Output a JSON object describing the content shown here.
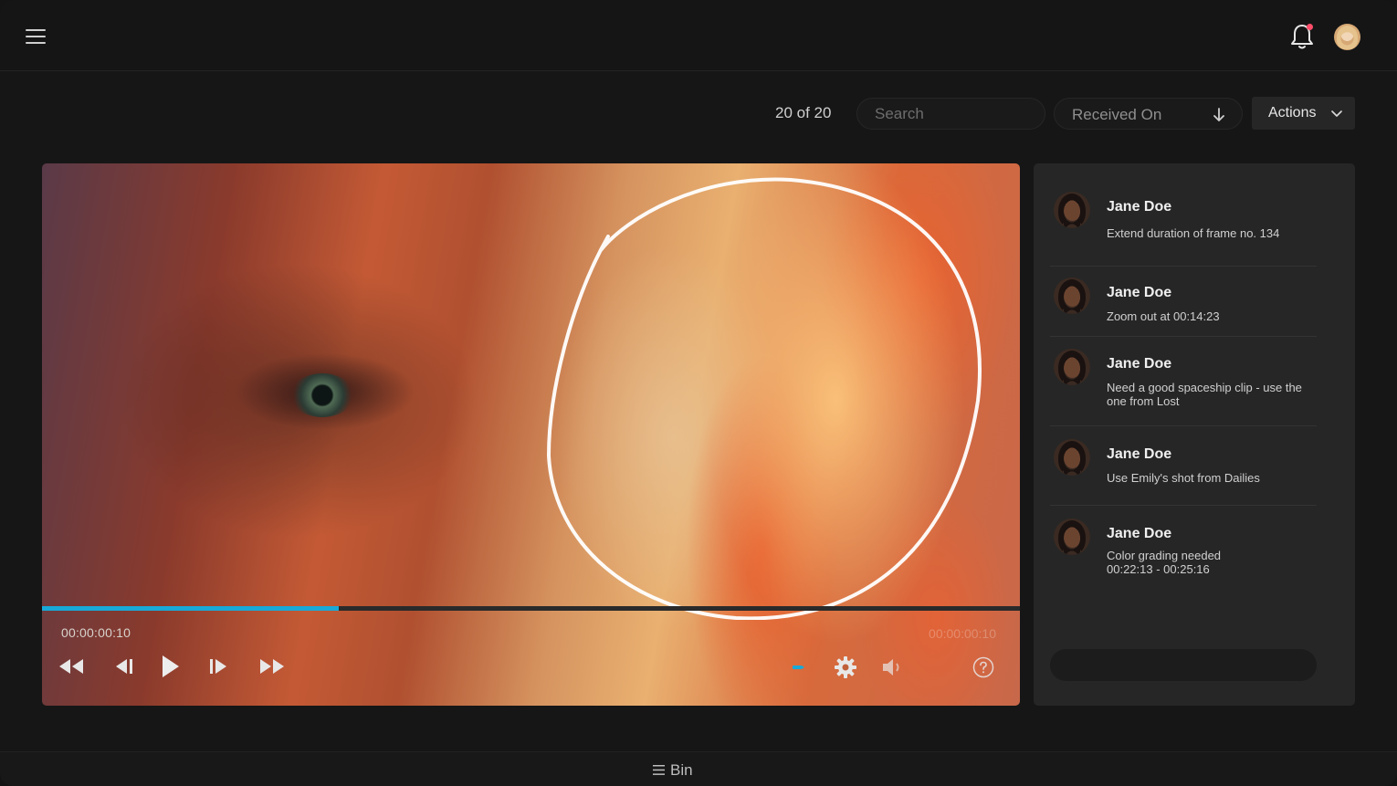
{
  "header": {
    "menu_icon": "hamburger-icon",
    "notification_icon": "bell-icon",
    "notification_dot_color": "#ff4d6a"
  },
  "toolbar": {
    "count": "20 of 20",
    "search_placeholder": "Search",
    "sort_label": "Received On",
    "sort_icon": "arrow-down-icon",
    "actions_label": "Actions",
    "actions_icon": "chevron-down-icon"
  },
  "player": {
    "current_time": "00:00:00:10",
    "end_time": "00:00:00:10",
    "progress": 0.303,
    "accent_color": "#18a9d8",
    "controls": [
      "rewind-icon",
      "step-back-icon",
      "play-icon",
      "step-forward-icon",
      "fast-forward-icon",
      "annotate-icon",
      "settings-gear-icon",
      "volume-icon",
      "help-icon"
    ]
  },
  "comments": {
    "items": [
      {
        "name": "Jane Doe",
        "text": "Extend duration of frame no. 134"
      },
      {
        "name": "Jane Doe",
        "text": "Zoom out at 00:14:23"
      },
      {
        "name": "Jane Doe",
        "text": "Need a good spaceship clip - use the one from Lost"
      },
      {
        "name": "Jane Doe",
        "text": "Use Emily's shot from Dailies"
      },
      {
        "name": "Jane Doe",
        "text": "Color grading needed 00:22:13 - 00:25:16"
      }
    ],
    "reply_placeholder": ""
  },
  "bin": {
    "label": "Bin",
    "icon": "list-icon"
  }
}
